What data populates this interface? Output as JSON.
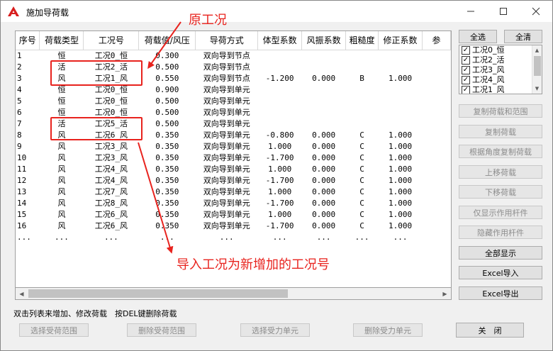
{
  "window": {
    "title": "施加导荷载",
    "minimize_icon": "minimize-icon",
    "maximize_icon": "maximize-icon",
    "close_icon": "close-icon"
  },
  "table": {
    "headers": [
      "序号",
      "荷载类型",
      "工况号",
      "荷载值/风压",
      "导荷方式",
      "体型系数",
      "风振系数",
      "粗糙度",
      "修正系数",
      "参"
    ],
    "rows": [
      [
        "1",
        "恒",
        "工况0_恒",
        "0.300",
        "双向导到节点",
        "",
        "",
        "",
        ""
      ],
      [
        "2",
        "活",
        "工况2_活",
        "0.500",
        "双向导到节点",
        "",
        "",
        "",
        ""
      ],
      [
        "3",
        "风",
        "工况1_风",
        "0.550",
        "双向导到节点",
        "-1.200",
        "0.000",
        "B",
        "1.000"
      ],
      [
        "4",
        "恒",
        "工况0_恒",
        "0.900",
        "双向导到单元",
        "",
        "",
        "",
        ""
      ],
      [
        "5",
        "恒",
        "工况0_恒",
        "0.500",
        "双向导到单元",
        "",
        "",
        "",
        ""
      ],
      [
        "6",
        "恒",
        "工况0_恒",
        "0.500",
        "双向导到单元",
        "",
        "",
        "",
        ""
      ],
      [
        "7",
        "活",
        "工况5_活",
        "0.500",
        "双向导到单元",
        "",
        "",
        "",
        ""
      ],
      [
        "8",
        "风",
        "工况6_风",
        "0.350",
        "双向导到单元",
        "-0.800",
        "0.000",
        "C",
        "1.000"
      ],
      [
        "9",
        "风",
        "工况3_风",
        "0.350",
        "双向导到单元",
        "1.000",
        "0.000",
        "C",
        "1.000"
      ],
      [
        "10",
        "风",
        "工况3_风",
        "0.350",
        "双向导到单元",
        "-1.700",
        "0.000",
        "C",
        "1.000"
      ],
      [
        "11",
        "风",
        "工况4_风",
        "0.350",
        "双向导到单元",
        "1.000",
        "0.000",
        "C",
        "1.000"
      ],
      [
        "12",
        "风",
        "工况4_风",
        "0.350",
        "双向导到单元",
        "-1.700",
        "0.000",
        "C",
        "1.000"
      ],
      [
        "13",
        "风",
        "工况7_风",
        "0.350",
        "双向导到单元",
        "1.000",
        "0.000",
        "C",
        "1.000"
      ],
      [
        "14",
        "风",
        "工况8_风",
        "0.350",
        "双向导到单元",
        "-1.700",
        "0.000",
        "C",
        "1.000"
      ],
      [
        "15",
        "风",
        "工况6_风",
        "0.350",
        "双向导到单元",
        "1.000",
        "0.000",
        "C",
        "1.000"
      ],
      [
        "16",
        "风",
        "工况6_风",
        "0.350",
        "双向导到单元",
        "-1.700",
        "0.000",
        "C",
        "1.000"
      ],
      [
        "...",
        "...",
        "...",
        "...",
        "...",
        "...",
        "...",
        "...",
        "..."
      ]
    ]
  },
  "right_panel": {
    "select_all": "全选",
    "clear_all": "全清",
    "load_cases": [
      {
        "label": "工况0_恒",
        "checked": "✓"
      },
      {
        "label": "工况2_活",
        "checked": "✓"
      },
      {
        "label": "工况3_风",
        "checked": "✓"
      },
      {
        "label": "工况4_风",
        "checked": "✓"
      },
      {
        "label": "工况1_风",
        "checked": "✓"
      }
    ],
    "buttons": {
      "copy_load_range": "复制荷载和范围",
      "copy_load": "复制荷载",
      "copy_by_angle": "根据角度复制荷载",
      "move_up": "上移荷载",
      "move_down": "下移荷载",
      "show_active_only": "仅显示作用杆件",
      "hide_active": "隐藏作用杆件",
      "show_all": "全部显示",
      "excel_import": "Excel导入",
      "excel_export": "Excel导出"
    }
  },
  "hint": "双击列表来增加、修改荷载　按DEL键删除荷载",
  "bottom_buttons": {
    "select_range": "选择受荷范围",
    "delete_range": "删除受荷范围",
    "select_unit": "选择受力单元",
    "delete_unit": "删除受力单元",
    "close": "关　闭"
  },
  "annotations": {
    "original_case": "原工况",
    "imported_case": "导入工况为新增加的工况号"
  },
  "colors": {
    "annotation": "#e8231e",
    "window_bg": "#f0f0f0",
    "autocad_red": "#d81e1e"
  }
}
